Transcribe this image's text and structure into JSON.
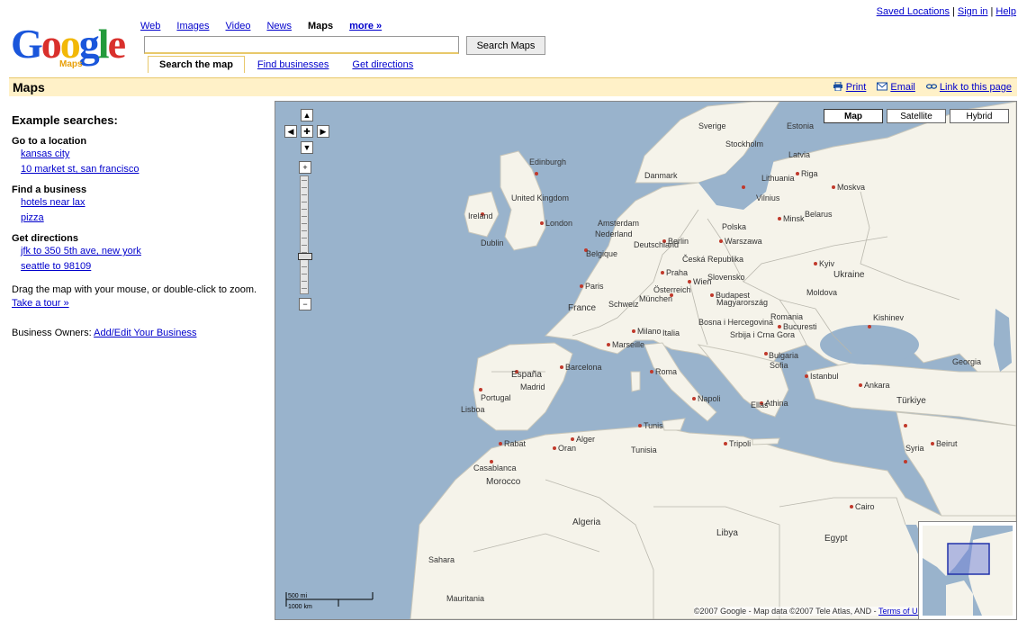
{
  "header": {
    "logo_text": "Google",
    "logo_sub": "Maps",
    "nav": [
      "Web",
      "Images",
      "Video",
      "News",
      "Maps",
      "more »"
    ],
    "nav_current": "Maps",
    "search_value": "",
    "search_button": "Search Maps",
    "subtabs": [
      "Search the map",
      "Find businesses",
      "Get directions"
    ],
    "toplinks": [
      "Saved Locations",
      "Sign in",
      "Help"
    ]
  },
  "bar": {
    "title": "Maps",
    "print": "Print",
    "email": "Email",
    "link": "Link to this page"
  },
  "sidebar": {
    "heading": "Example searches:",
    "groups": [
      {
        "title": "Go to a location",
        "items": [
          "kansas city",
          "10 market st, san francisco"
        ]
      },
      {
        "title": "Find a business",
        "items": [
          "hotels near lax",
          "pizza"
        ]
      },
      {
        "title": "Get directions",
        "items": [
          "jfk to 350 5th ave, new york",
          "seattle to 98109"
        ]
      }
    ],
    "drag_text": "Drag the map with your mouse, or double-click to zoom.",
    "tour_link": "Take a tour »",
    "owners_label": "Business Owners:",
    "owners_link": "Add/Edit Your Business"
  },
  "map": {
    "types": [
      "Map",
      "Satellite",
      "Hybrid"
    ],
    "selected_type": "Map",
    "zoom_level_fraction": 0.7,
    "scale_top": "500 mi",
    "scale_bottom": "1000 km",
    "copyright": "©2007 Google - Map data ©2007 Tele Atlas, AND -",
    "terms": "Terms of Use",
    "labels": {
      "countries": [
        "Algeria",
        "Libya",
        "Egypt",
        "Morocco",
        "España",
        "France",
        "Portugal",
        "Italia",
        "Deutschland",
        "Polska",
        "Ukraine",
        "Romania",
        "Türkiye",
        "Syria",
        "Belarus",
        "Latvia",
        "Lithuania",
        "Estonia",
        "Bulgaria",
        "Magyarország",
        "Česká Republika",
        "Slovensko",
        "Österreich",
        "Schweiz",
        "Nederland",
        "Belgique",
        "Sverige",
        "Danmark",
        "Ireland",
        "United Kingdom",
        "Sahara",
        "Mauritania",
        "Moldova",
        "Ellas",
        "Srbija i Crna Gora",
        "Bosna i Hercegovina",
        "Georgia",
        "Tunisia"
      ],
      "cities": [
        "London",
        "Paris",
        "Berlin",
        "Madrid",
        "Roma",
        "Warszawa",
        "Kyiv",
        "Minsk",
        "Moskva",
        "Wien",
        "Praha",
        "Budapest",
        "Bucuresti",
        "Sofia",
        "Istanbul",
        "Ankara",
        "Athina",
        "Tunis",
        "Alger",
        "Rabat",
        "Tripoli",
        "Cairo",
        "Lisboa",
        "Barcelona",
        "Milano",
        "Stockholm",
        "Riga",
        "Vilnius",
        "Dublin",
        "Edinburgh",
        "Amsterdam",
        "München",
        "Napoli",
        "Beirut",
        "Kishinev",
        "Marseille",
        "Oran",
        "Casablanca"
      ]
    }
  },
  "colors": {
    "link": "#0000cc",
    "bar_bg": "#fff1c8",
    "water": "#99b3cc",
    "land": "#f5f3ea",
    "border": "#a0a0a0"
  }
}
